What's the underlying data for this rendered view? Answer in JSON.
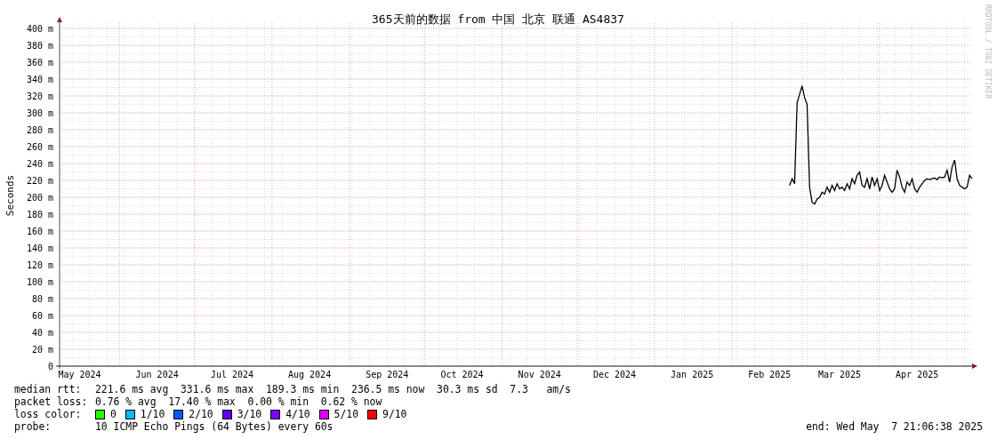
{
  "title": "365天前的数据 from 中国 北京 联通 AS4837",
  "side_text": "RRDTOOL / TOBI OETIKER",
  "chart": {
    "chart_data": {
      "type": "line",
      "grid": true,
      "ylabel": "Seconds",
      "xlim": [
        "2024-05-08",
        "2025-05-08"
      ],
      "ylim": [
        0,
        400
      ],
      "yticks": [
        {
          "value": 0,
          "label": "0"
        },
        {
          "value": 20,
          "label": "20 m"
        },
        {
          "value": 40,
          "label": "40 m"
        },
        {
          "value": 60,
          "label": "60 m"
        },
        {
          "value": 80,
          "label": "80 m"
        },
        {
          "value": 100,
          "label": "100 m"
        },
        {
          "value": 120,
          "label": "120 m"
        },
        {
          "value": 140,
          "label": "140 m"
        },
        {
          "value": 160,
          "label": "160 m"
        },
        {
          "value": 180,
          "label": "180 m"
        },
        {
          "value": 200,
          "label": "200 m"
        },
        {
          "value": 220,
          "label": "220 m"
        },
        {
          "value": 240,
          "label": "240 m"
        },
        {
          "value": 260,
          "label": "260 m"
        },
        {
          "value": 280,
          "label": "280 m"
        },
        {
          "value": 300,
          "label": "300 m"
        },
        {
          "value": 320,
          "label": "320 m"
        },
        {
          "value": 340,
          "label": "340 m"
        },
        {
          "value": 360,
          "label": "360 m"
        },
        {
          "value": 380,
          "label": "380 m"
        },
        {
          "value": 400,
          "label": "400 m"
        }
      ],
      "xticks": [
        {
          "value": "2024-05-16",
          "label": "May 2024"
        },
        {
          "value": "2024-06-16",
          "label": "Jun 2024"
        },
        {
          "value": "2024-07-16",
          "label": "Jul 2024"
        },
        {
          "value": "2024-08-16",
          "label": "Aug 2024"
        },
        {
          "value": "2024-09-16",
          "label": "Sep 2024"
        },
        {
          "value": "2024-10-16",
          "label": "Oct 2024"
        },
        {
          "value": "2024-11-16",
          "label": "Nov 2024"
        },
        {
          "value": "2024-12-16",
          "label": "Dec 2024"
        },
        {
          "value": "2025-01-16",
          "label": "Jan 2025"
        },
        {
          "value": "2025-02-16",
          "label": "Feb 2025"
        },
        {
          "value": "2025-03-16",
          "label": "Mar 2025"
        },
        {
          "value": "2025-04-16",
          "label": "Apr 2025"
        }
      ],
      "x": [
        "2025-02-24",
        "2025-02-25",
        "2025-02-26",
        "2025-02-27",
        "2025-02-28",
        "2025-03-01",
        "2025-03-02",
        "2025-03-03",
        "2025-03-04",
        "2025-03-05",
        "2025-03-06",
        "2025-03-07",
        "2025-03-08",
        "2025-03-09",
        "2025-03-10",
        "2025-03-11",
        "2025-03-12",
        "2025-03-13",
        "2025-03-14",
        "2025-03-15",
        "2025-03-16",
        "2025-03-17",
        "2025-03-18",
        "2025-03-19",
        "2025-03-20",
        "2025-03-21",
        "2025-03-22",
        "2025-03-23",
        "2025-03-24",
        "2025-03-25",
        "2025-03-26",
        "2025-03-27",
        "2025-03-28",
        "2025-03-29",
        "2025-03-30",
        "2025-03-31",
        "2025-04-01",
        "2025-04-02",
        "2025-04-03",
        "2025-04-04",
        "2025-04-05",
        "2025-04-06",
        "2025-04-07",
        "2025-04-08",
        "2025-04-09",
        "2025-04-10",
        "2025-04-11",
        "2025-04-12",
        "2025-04-13",
        "2025-04-14",
        "2025-04-15",
        "2025-04-16",
        "2025-04-17",
        "2025-04-18",
        "2025-04-19",
        "2025-04-20",
        "2025-04-21",
        "2025-04-22",
        "2025-04-23",
        "2025-04-24",
        "2025-04-25",
        "2025-04-26",
        "2025-04-27",
        "2025-04-28",
        "2025-04-29",
        "2025-04-30",
        "2025-05-01",
        "2025-05-02",
        "2025-05-03",
        "2025-05-04",
        "2025-05-05",
        "2025-05-06",
        "2025-05-07",
        "2025-05-08"
      ],
      "series": [
        {
          "color": "#000000",
          "values": [
            214,
            222,
            216,
            312,
            322,
            332,
            318,
            310,
            212,
            194,
            192,
            198,
            200,
            206,
            204,
            212,
            206,
            214,
            208,
            216,
            210,
            212,
            208,
            216,
            210,
            222,
            216,
            226,
            230,
            214,
            212,
            222,
            210,
            224,
            214,
            222,
            208,
            214,
            226,
            218,
            210,
            206,
            210,
            232,
            224,
            212,
            206,
            218,
            214,
            222,
            210,
            206,
            212,
            216,
            220,
            222,
            221,
            222,
            223,
            221,
            224,
            223,
            224,
            232,
            218,
            236,
            244,
            222,
            214,
            212,
            210,
            212,
            226,
            222
          ]
        }
      ]
    }
  },
  "stats": [
    {
      "label": "median rtt:",
      "text": "221.6 ms avg  331.6 ms max  189.3 ms min  236.5 ms now  30.3 ms sd  7.3   am/s"
    },
    {
      "label": "packet loss:",
      "text": "0.76 % avg  17.40 % max  0.00 % min  0.62 % now"
    }
  ],
  "loss_color": {
    "label": "loss color:",
    "items": [
      {
        "label": "0",
        "color": "#26ff00"
      },
      {
        "label": "1/10",
        "color": "#00b8ff"
      },
      {
        "label": "2/10",
        "color": "#0059ff"
      },
      {
        "label": "3/10",
        "color": "#5e00ff"
      },
      {
        "label": "4/10",
        "color": "#7e00ff"
      },
      {
        "label": "5/10",
        "color": "#dd00ff"
      },
      {
        "label": "9/10",
        "color": "#ff0000"
      }
    ]
  },
  "probe": {
    "label": "probe:",
    "text": "10 ICMP Echo Pings (64 Bytes) every 60s"
  },
  "end": "end: Wed May  7 21:06:38 2025"
}
